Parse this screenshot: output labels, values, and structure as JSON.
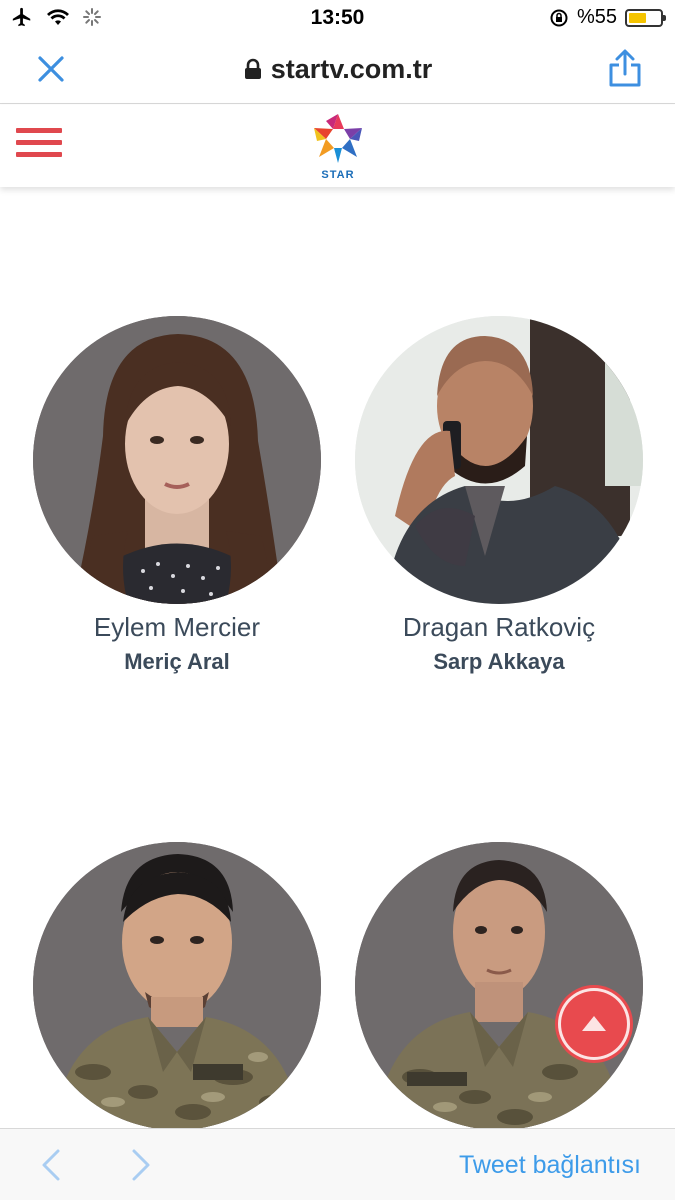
{
  "status_bar": {
    "time": "13:50",
    "battery_text": "%55",
    "battery_level": 0.55,
    "icons": [
      "airplane-icon",
      "wifi-icon",
      "activity-spinner-icon",
      "orientation-lock-icon",
      "battery-icon"
    ]
  },
  "browser": {
    "url": "startv.com.tr",
    "close_icon": "close-icon",
    "share_icon": "share-icon",
    "lock_icon": "lock-icon"
  },
  "site_header": {
    "logo_text": "STAR",
    "menu_icon": "hamburger-menu-icon"
  },
  "cast": [
    {
      "character": "Eylem Mercier",
      "actor": "Meriç Aral"
    },
    {
      "character": "Dragan Ratkoviç",
      "actor": "Sarp Akkaya"
    },
    {
      "character": "",
      "actor": ""
    },
    {
      "character": "",
      "actor": ""
    }
  ],
  "toolbar": {
    "tweet_label": "Tweet bağlantısı",
    "back_icon": "chevron-left-icon",
    "forward_icon": "chevron-right-icon"
  },
  "colors": {
    "accent_red": "#e0484e",
    "link_blue": "#3d9be9",
    "text_dark": "#3b4a5a"
  }
}
